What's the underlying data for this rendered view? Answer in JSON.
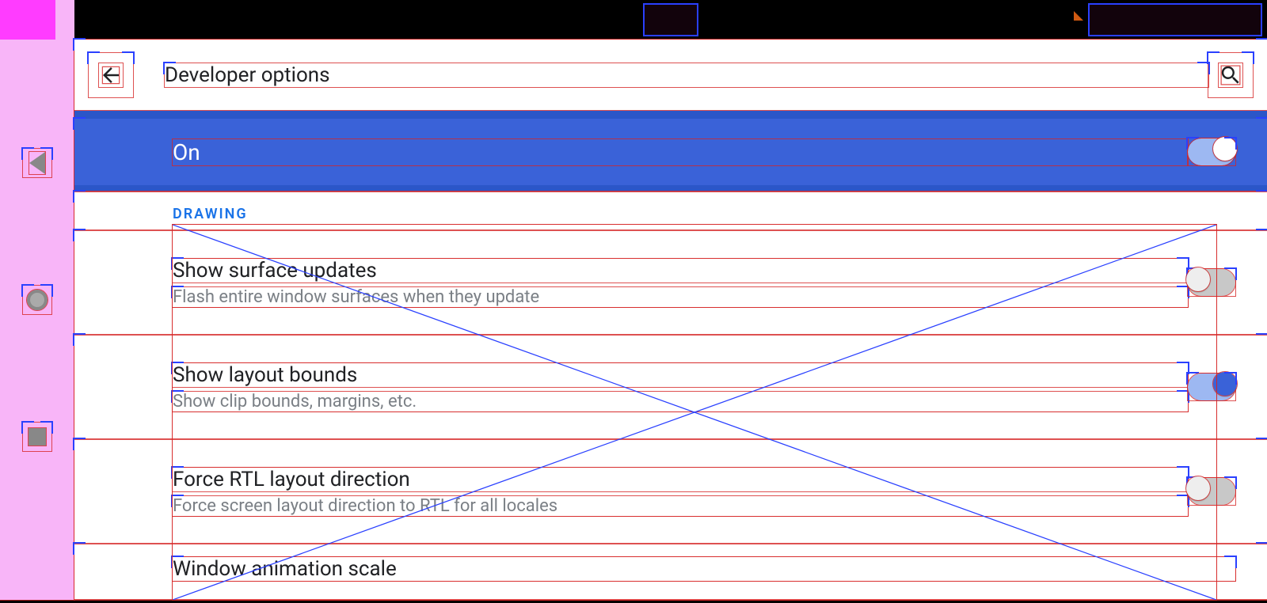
{
  "appbar": {
    "title": "Developer options"
  },
  "master": {
    "label": "On",
    "enabled": true
  },
  "section": {
    "label": "DRAWING"
  },
  "rows": [
    {
      "title": "Show surface updates",
      "subtitle": "Flash entire window surfaces when they update",
      "toggle": "off"
    },
    {
      "title": "Show layout bounds",
      "subtitle": "Show clip bounds, margins, etc.",
      "toggle": "on"
    },
    {
      "title": "Force RTL layout direction",
      "subtitle": "Force screen layout direction to RTL for all locales",
      "toggle": "off"
    },
    {
      "title": "Window animation scale",
      "subtitle": "",
      "toggle": "none"
    }
  ],
  "nav": {
    "back": "back",
    "home": "home",
    "recent": "recent"
  }
}
